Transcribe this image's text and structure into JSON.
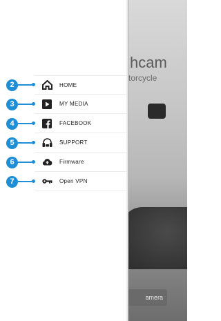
{
  "background": {
    "title_fragment": "hcam",
    "subtitle_fragment": "torcycle",
    "button_fragment": "amera"
  },
  "menu": {
    "items": [
      {
        "number": "2",
        "label": "HOME",
        "icon": "home-icon"
      },
      {
        "number": "3",
        "label": "MY MEDIA",
        "icon": "play-icon"
      },
      {
        "number": "4",
        "label": "FACEBOOK",
        "icon": "facebook-icon"
      },
      {
        "number": "5",
        "label": "SUPPORT",
        "icon": "support-headset-icon"
      },
      {
        "number": "6",
        "label": "Firmware",
        "icon": "cloud-upload-icon"
      },
      {
        "number": "7",
        "label": "Open VPN",
        "icon": "key-icon"
      }
    ]
  },
  "colors": {
    "accent": "#1e8fd6",
    "text": "#222222"
  }
}
